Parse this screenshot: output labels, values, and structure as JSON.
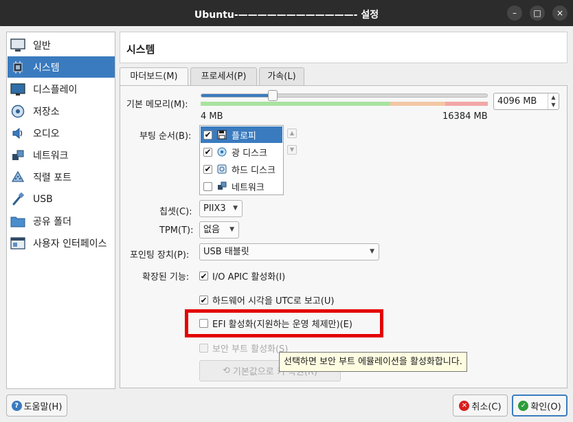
{
  "window": {
    "title": "Ubuntu-————————————- 설정"
  },
  "window_controls": {
    "minimize": "–",
    "maximize": "□",
    "close": "×"
  },
  "sidebar": {
    "items": [
      {
        "label": "일반",
        "icon": "monitor-icon"
      },
      {
        "label": "시스템",
        "icon": "chip-icon",
        "selected": true
      },
      {
        "label": "디스플레이",
        "icon": "display-icon"
      },
      {
        "label": "저장소",
        "icon": "disk-icon"
      },
      {
        "label": "오디오",
        "icon": "speaker-icon"
      },
      {
        "label": "네트워크",
        "icon": "network-icon"
      },
      {
        "label": "직렬 포트",
        "icon": "serial-port-icon"
      },
      {
        "label": "USB",
        "icon": "usb-icon"
      },
      {
        "label": "공유 폴더",
        "icon": "folder-icon"
      },
      {
        "label": "사용자 인터페이스",
        "icon": "window-icon"
      }
    ]
  },
  "page": {
    "title": "시스템"
  },
  "tabs": [
    {
      "label": "마더보드(M)",
      "active": true
    },
    {
      "label": "프로세서(P)"
    },
    {
      "label": "가속(L)"
    }
  ],
  "motherboard": {
    "memory_label": "기본 메모리(M):",
    "memory_min": "4 MB",
    "memory_max": "16384 MB",
    "memory_value": "4096 MB",
    "memory_fraction": 0.25,
    "boot_order_label": "부팅 순서(B):",
    "boot_items": [
      {
        "label": "플로피",
        "checked": true,
        "icon": "floppy-icon",
        "selected": true
      },
      {
        "label": "광 디스크",
        "checked": true,
        "icon": "optical-disc-icon"
      },
      {
        "label": "하드 디스크",
        "checked": true,
        "icon": "hard-disk-icon"
      },
      {
        "label": "네트워크",
        "checked": false,
        "icon": "network-icon"
      }
    ],
    "chipset_label": "칩셋(C):",
    "chipset_value": "PIIX3",
    "tpm_label": "TPM(T):",
    "tpm_value": "없음",
    "pointing_label": "포인팅 장치(P):",
    "pointing_value": "USB 태블릿",
    "extended_label": "확장된 기능:",
    "ioapic_label": "I/O APIC 활성화(I)",
    "utc_label": "하드웨어 시각을 UTC로 보고(U)",
    "efi_label": "EFI 활성화(지원하는 운영 체제만)(E)",
    "secure_boot_label": "보안 부트 활성화(S)",
    "reset_keys_label": "기본값으로 키 복원(R)",
    "tooltip": "선택하면 보안 부트 에뮬레이션을 활성화합니다."
  },
  "buttons": {
    "help": "도움말(H)",
    "cancel": "취소(C)",
    "ok": "확인(O)"
  },
  "colors": {
    "accent": "#3a7bbf",
    "highlight": "#e30000",
    "titlebar": "#2c2c2c",
    "tooltip_bg": "#fffde1"
  }
}
